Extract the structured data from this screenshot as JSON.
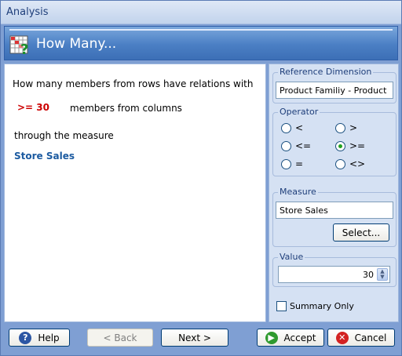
{
  "window": {
    "title": "Analysis"
  },
  "banner": {
    "title": "How Many...",
    "icon": "grid-question-icon"
  },
  "main": {
    "line1": "How many members from rows have relations with",
    "operator_value": ">= 30",
    "line2": "members from columns",
    "line3": "through the measure",
    "measure": "Store Sales"
  },
  "reference_dimension": {
    "legend": "Reference Dimension",
    "value": "Product Familiy - Product"
  },
  "operator": {
    "legend": "Operator",
    "options": [
      "<",
      ">",
      "<=",
      ">=",
      "=",
      "<>"
    ],
    "selected": ">="
  },
  "measure": {
    "legend": "Measure",
    "value": "Store Sales",
    "select_button": "Select..."
  },
  "value": {
    "legend": "Value",
    "value": "30"
  },
  "summary_only": {
    "label": "Summary Only",
    "checked": false
  },
  "footer": {
    "help": "Help",
    "back": "< Back",
    "next": "Next >",
    "accept": "Accept",
    "cancel": "Cancel"
  },
  "colors": {
    "accent": "#3c6fb6",
    "operator_value": "#cc0000",
    "measure_name": "#1b5aa0"
  }
}
